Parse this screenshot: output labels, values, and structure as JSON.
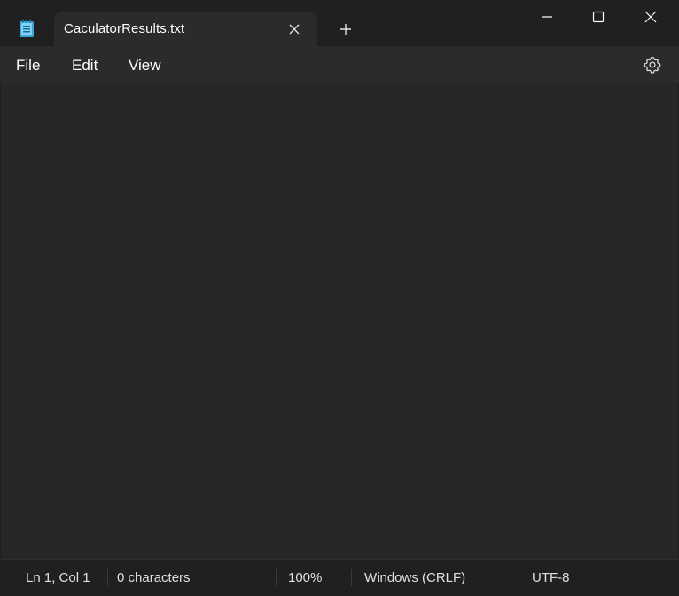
{
  "window": {
    "tab_title": "CaculatorResults.txt"
  },
  "menu": {
    "file": "File",
    "edit": "Edit",
    "view": "View"
  },
  "editor": {
    "content": ""
  },
  "status": {
    "position": "Ln 1, Col 1",
    "characters": "0 characters",
    "zoom": "100%",
    "line_ending": "Windows (CRLF)",
    "encoding": "UTF-8"
  },
  "icons": {
    "app": "notepad-icon",
    "close_tab": "close-icon",
    "new_tab": "plus-icon",
    "minimize": "minimize-icon",
    "maximize": "maximize-icon",
    "close_window": "close-icon",
    "settings": "gear-icon"
  },
  "colors": {
    "titlebar": "#202020",
    "tab_active": "#2b2b2b",
    "editor_bg": "#272727",
    "app_icon": "#5bc0eb"
  }
}
